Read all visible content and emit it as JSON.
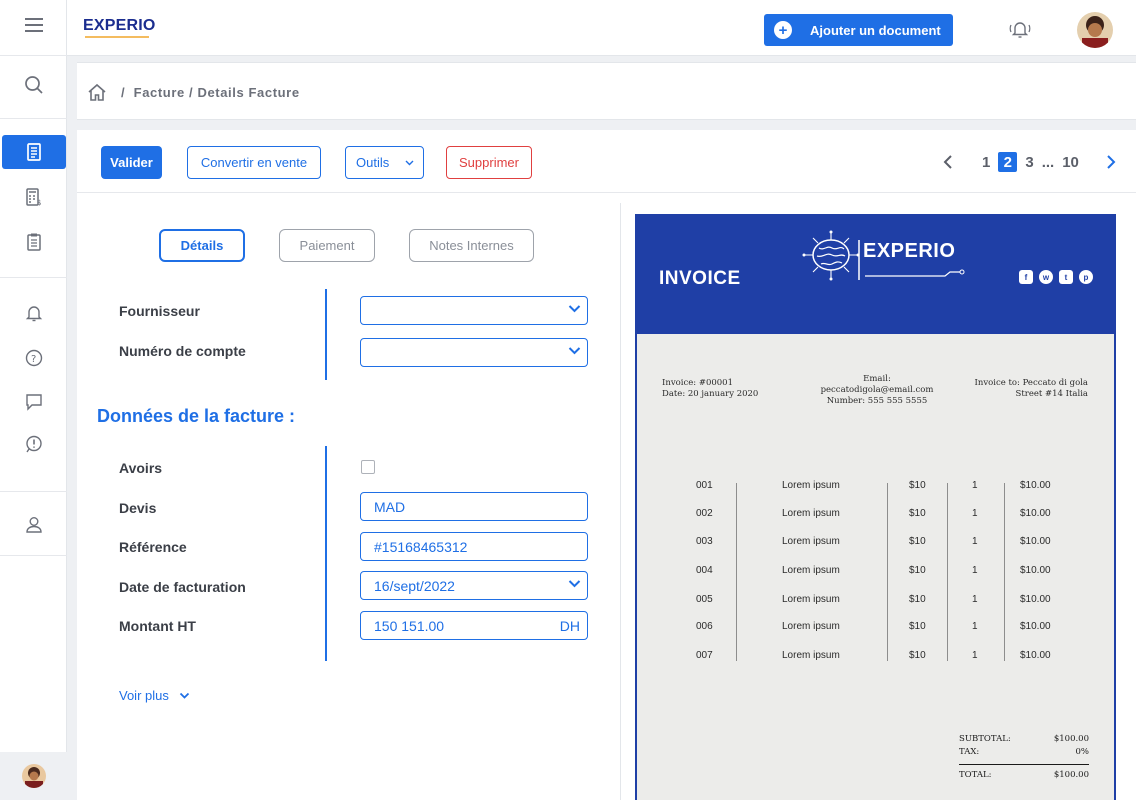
{
  "topbar": {
    "logo": "EXPERIO",
    "add_document_label": "Ajouter un document",
    "colors": {
      "accent": "#1f6fe5",
      "brand_dark": "#1b2d8f",
      "danger": "#e04040"
    }
  },
  "sidebar": {
    "icons": [
      "menu-icon",
      "search-icon",
      "invoice-icon",
      "calculator-icon",
      "clipboard-icon",
      "bell-icon",
      "help-icon",
      "chat-icon",
      "alert-icon",
      "user-icon"
    ],
    "active": "invoice-icon"
  },
  "breadcrumb": {
    "separator": "/",
    "path": "Facture / Details Facture"
  },
  "toolbar": {
    "valider": "Valider",
    "convertir": "Convertir en vente",
    "outils": "Outils",
    "supprimer": "Supprimer"
  },
  "pagination": {
    "pages": [
      "1",
      "2",
      "3"
    ],
    "ellipsis": "...",
    "last": "10",
    "current": "2"
  },
  "tabs": {
    "details": "Détails",
    "paiement": "Paiement",
    "notes": "Notes Internes"
  },
  "form": {
    "fournisseur_label": "Fournisseur",
    "fournisseur_value": "",
    "compte_label": "Numéro de compte",
    "compte_value": "",
    "section_title": "Données de la facture :",
    "avoirs_label": "Avoirs",
    "avoirs_checked": false,
    "devis_label": "Devis",
    "devis_value": "MAD",
    "reference_label": "Référence",
    "reference_value": "#15168465312",
    "date_label": "Date de facturation",
    "date_value": "16/sept/2022",
    "montant_label": "Montant HT",
    "montant_value": "150 151.00",
    "montant_suffix": "DH",
    "voir_plus": "Voir plus"
  },
  "invoice": {
    "title": "INVOICE",
    "brand": "EXPERIO",
    "social": [
      "facebook-icon",
      "whatsapp-icon",
      "twitter-icon",
      "pinterest-icon"
    ],
    "invoice_no": "Invoice: #00001",
    "date": "Date: 20 january 2020",
    "email": "Email: peccatodigola@email.com",
    "number": "Number: 555 555 5555",
    "invoice_to": "Invoice to: Peccato di gola",
    "street": "Street #14 Italia",
    "rows": [
      {
        "id": "001",
        "desc": "Lorem ipsum",
        "price": "$10",
        "qty": "1",
        "total": "$10.00"
      },
      {
        "id": "002",
        "desc": "Lorem ipsum",
        "price": "$10",
        "qty": "1",
        "total": "$10.00"
      },
      {
        "id": "003",
        "desc": "Lorem ipsum",
        "price": "$10",
        "qty": "1",
        "total": "$10.00"
      },
      {
        "id": "004",
        "desc": "Lorem ipsum",
        "price": "$10",
        "qty": "1",
        "total": "$10.00"
      },
      {
        "id": "005",
        "desc": "Lorem ipsum",
        "price": "$10",
        "qty": "1",
        "total": "$10.00"
      },
      {
        "id": "006",
        "desc": "Lorem ipsum",
        "price": "$10",
        "qty": "1",
        "total": "$10.00"
      },
      {
        "id": "007",
        "desc": "Lorem ipsum",
        "price": "$10",
        "qty": "1",
        "total": "$10.00"
      }
    ],
    "subtotal_label": "SUBTOTAL:",
    "subtotal": "$100.00",
    "tax_label": "TAX:",
    "tax": "0%",
    "total_label": "TOTAL:",
    "total": "$100.00"
  }
}
